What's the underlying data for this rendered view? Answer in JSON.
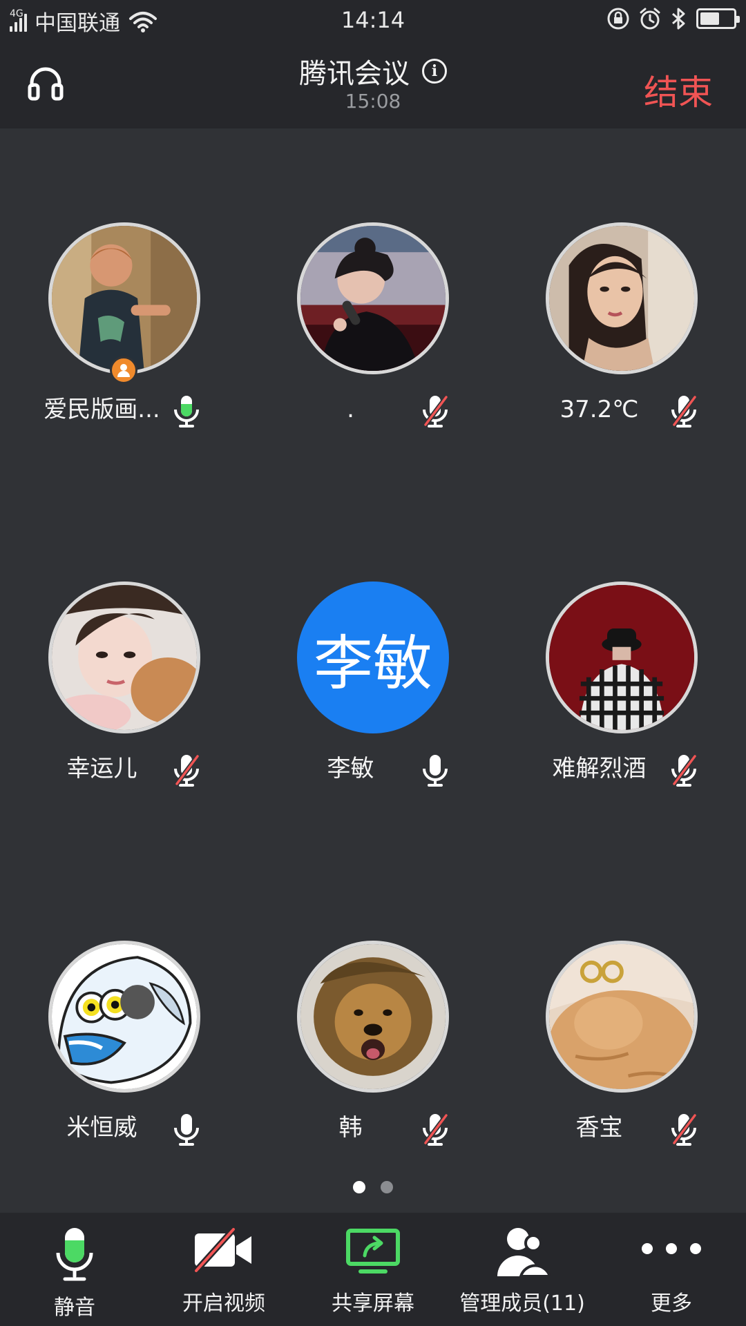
{
  "status_bar": {
    "network_type": "4G",
    "carrier": "中国联通",
    "time": "14:14",
    "battery_level": 0.52
  },
  "header": {
    "title": "腾讯会议",
    "duration": "15:08",
    "end_label": "结束"
  },
  "participants": [
    {
      "name": "爱民版画...",
      "mic": "on-active",
      "is_host": true,
      "avatar": "photo-child"
    },
    {
      "name": ".",
      "mic": "muted",
      "is_host": false,
      "avatar": "photo-singer"
    },
    {
      "name": "37.2℃",
      "mic": "muted",
      "is_host": false,
      "avatar": "photo-woman"
    },
    {
      "name": "幸运儿",
      "mic": "muted",
      "is_host": false,
      "avatar": "photo-girl-dog"
    },
    {
      "name": "李敏",
      "mic": "on",
      "is_host": false,
      "avatar": "initials",
      "initials": "李敏"
    },
    {
      "name": "难解烈酒",
      "mic": "muted",
      "is_host": false,
      "avatar": "photo-red-back"
    },
    {
      "name": "米恒威",
      "mic": "on",
      "is_host": false,
      "avatar": "cartoon-fish"
    },
    {
      "name": "韩",
      "mic": "muted",
      "is_host": false,
      "avatar": "photo-lion-dog"
    },
    {
      "name": "香宝",
      "mic": "muted",
      "is_host": false,
      "avatar": "photo-cat"
    }
  ],
  "pagination": {
    "pages": 2,
    "current": 1
  },
  "toolbar": {
    "mute_label": "静音",
    "video_label": "开启视频",
    "share_label": "共享屏幕",
    "members_label": "管理成员(11)",
    "more_label": "更多"
  },
  "colors": {
    "background": "#303236",
    "bar_background": "#26272b",
    "end_red": "#f05454",
    "mic_green": "#4cd964",
    "initials_blue": "#1a7ff2",
    "host_orange": "#f08a2c"
  }
}
